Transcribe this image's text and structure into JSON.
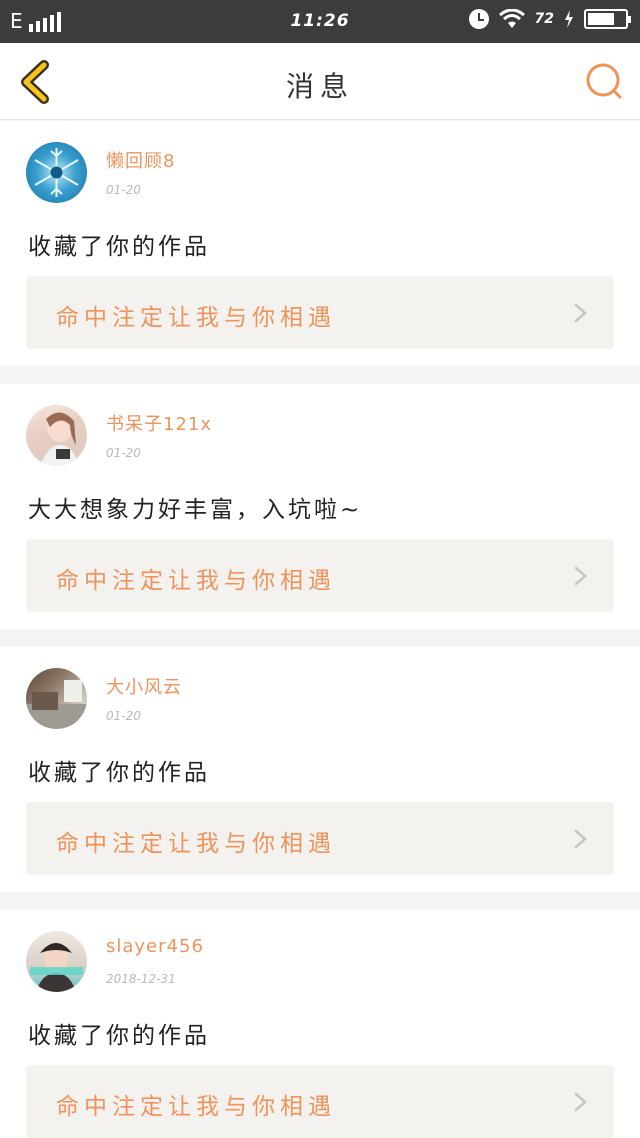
{
  "status_bar": {
    "network": "E",
    "time": "11:26",
    "battery_percent": "72",
    "battery_level": 0.72
  },
  "header": {
    "title": "消息",
    "back_icon": "chevron-left-icon",
    "search_icon": "search-icon"
  },
  "colors": {
    "accent": "#f0935a",
    "back_yellow": "#f5c518",
    "card_ref_bg": "#f3f2ee"
  },
  "messages": [
    {
      "username": "懒回顾8",
      "date": "01-20",
      "text": "收藏了你的作品",
      "work_title": "命中注定让我与你相遇",
      "avatar": "snowflake-avatar"
    },
    {
      "username": "书呆子121x",
      "date": "01-20",
      "text": "大大想象力好丰富，入坑啦~",
      "work_title": "命中注定让我与你相遇",
      "avatar": "girl-portrait-avatar"
    },
    {
      "username": "大小风云",
      "date": "01-20",
      "text": "收藏了你的作品",
      "work_title": "命中注定让我与你相遇",
      "avatar": "room-photo-avatar"
    },
    {
      "username": "slayer456",
      "date": "2018-12-31",
      "text": "收藏了你的作品",
      "work_title": "命中注定让我与你相遇",
      "avatar": "person-cap-avatar"
    }
  ]
}
